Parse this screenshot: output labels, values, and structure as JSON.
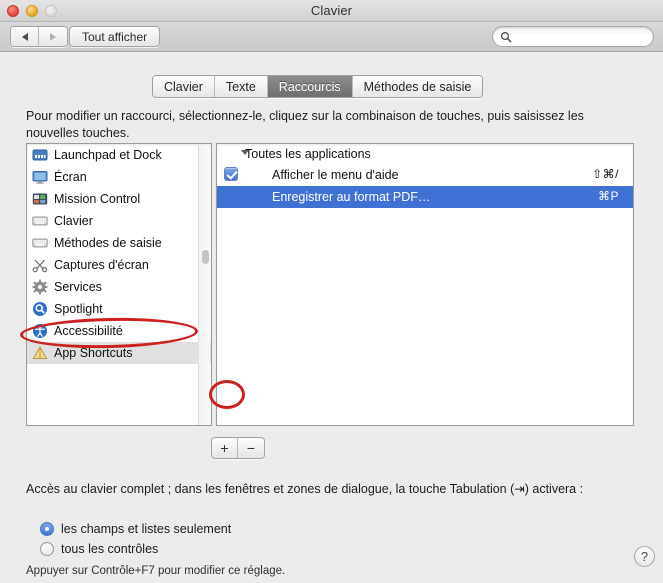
{
  "window": {
    "title": "Clavier",
    "controls": {
      "close": "close-button",
      "minimize": "minimize-button",
      "zoom": "zoom-button"
    }
  },
  "toolbar": {
    "back_label": "◀",
    "forward_label": "▶",
    "show_all_label": "Tout afficher",
    "search": {
      "value": "",
      "placeholder": ""
    }
  },
  "tabs": [
    {
      "label": "Clavier",
      "selected": false
    },
    {
      "label": "Texte",
      "selected": false
    },
    {
      "label": "Raccourcis",
      "selected": true
    },
    {
      "label": "Méthodes de saisie",
      "selected": false
    }
  ],
  "instructions": "Pour modifier un raccourci, sélectionnez-le, cliquez sur la combinaison de touches, puis saisissez les nouvelles touches.",
  "sidebar": {
    "items": [
      {
        "label": "Launchpad et Dock",
        "icon": "launchpad-dock-icon",
        "selected": false
      },
      {
        "label": "Écran",
        "icon": "display-icon",
        "selected": false
      },
      {
        "label": "Mission Control",
        "icon": "mission-control-icon",
        "selected": false
      },
      {
        "label": "Clavier",
        "icon": "keyboard-icon",
        "selected": false
      },
      {
        "label": "Méthodes de saisie",
        "icon": "input-methods-icon",
        "selected": false
      },
      {
        "label": "Captures d'écran",
        "icon": "screenshot-icon",
        "selected": false
      },
      {
        "label": "Services",
        "icon": "services-gear-icon",
        "selected": false
      },
      {
        "label": "Spotlight",
        "icon": "spotlight-icon",
        "selected": false
      },
      {
        "label": "Accessibilité",
        "icon": "accessibility-icon",
        "selected": false
      },
      {
        "label": "App Shortcuts",
        "icon": "app-shortcuts-icon",
        "selected": true
      }
    ]
  },
  "shortcuts": {
    "group_label": "Toutes les applications",
    "rows": [
      {
        "name": "Afficher le menu d'aide",
        "key": "⇧⌘/",
        "checked": true,
        "selected": false
      },
      {
        "name": "Enregistrer au format PDF…",
        "key": "⌘P",
        "checked": false,
        "selected": true
      }
    ]
  },
  "list_buttons": {
    "add_label": "+",
    "remove_label": "−"
  },
  "full_keyboard_access": {
    "description": "Accès au clavier complet ; dans les fenêtres et zones de dialogue, la touche Tabulation (⇥) activera :",
    "options": [
      {
        "label": "les champs et listes seulement",
        "selected": true
      },
      {
        "label": "tous les contrôles",
        "selected": false
      }
    ],
    "hint": "Appuyer sur Contrôle+F7 pour modifier ce réglage."
  },
  "help_button_label": "?",
  "annotations": {
    "color": "#cc2121",
    "shapes": [
      {
        "name": "app-shortcuts-highlight",
        "target": "App Shortcuts"
      },
      {
        "name": "add-button-highlight",
        "target": "+"
      }
    ]
  }
}
